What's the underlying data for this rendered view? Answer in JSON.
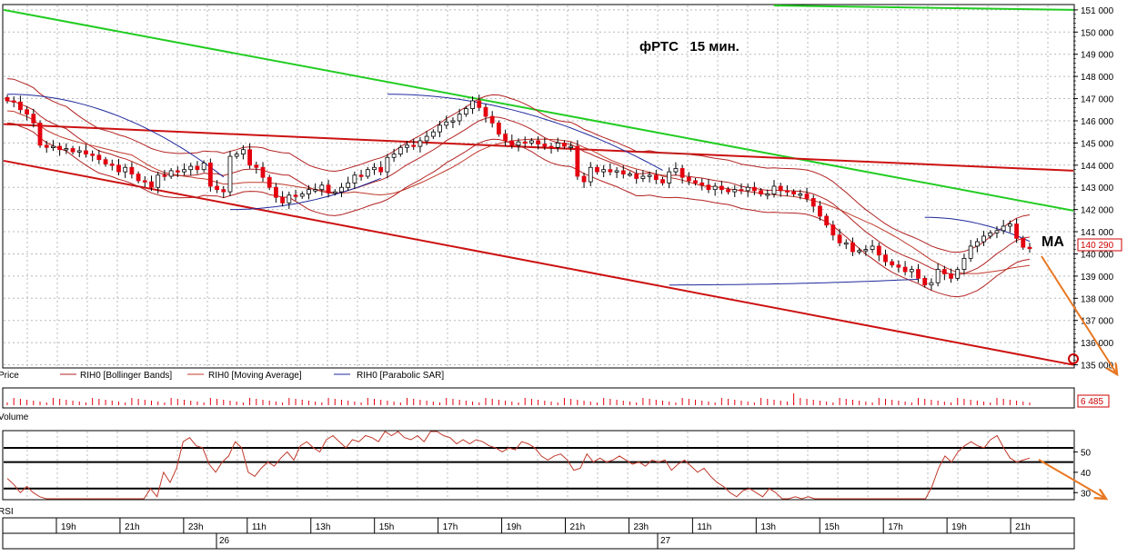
{
  "chart_title": "фРТС   15 мин.",
  "annotation_ma": "MA",
  "colors": {
    "up": "#ffffff",
    "down": "#e4000f",
    "bollinger": "#b22222",
    "ma": "#c0392b",
    "sar": "#1f2a9c",
    "trend_green": "#22cc22",
    "trend_red": "#cc1111",
    "arrow": "#e87722",
    "grid": "#b8b8b8"
  },
  "chart_data": [
    {
      "type": "candlestick",
      "title": "фРТС   15 мин.",
      "ylim": [
        134900,
        151200
      ],
      "y_ticks": [
        "151 000",
        "150 000",
        "149 000",
        "148 000",
        "147 000",
        "146 000",
        "145 000",
        "144 000",
        "143 000",
        "142 000",
        "141 000",
        "140 000",
        "139 000",
        "138 000",
        "137 000",
        "136 000",
        "135 000"
      ],
      "y_tick_values": [
        151000,
        150000,
        149000,
        148000,
        147000,
        146000,
        145000,
        144000,
        143000,
        142000,
        141000,
        140000,
        139000,
        138000,
        137000,
        136000,
        135000
      ],
      "last_price_label": "140 290",
      "last_price": 140290,
      "legend": [
        "Price",
        "RIH0 [Bollinger Bands]",
        "RIH0 [Moving Average]",
        "RIH0 [Parabolic SAR]"
      ],
      "grid": true,
      "close": [
        146900,
        146850,
        146500,
        146300,
        145900,
        144900,
        144800,
        144850,
        144700,
        144750,
        144600,
        144650,
        144500,
        144450,
        144250,
        144050,
        144000,
        143700,
        143900,
        143600,
        143300,
        143250,
        143000,
        143550,
        143500,
        143750,
        143700,
        143800,
        143950,
        143800,
        144100,
        143050,
        142900,
        142800,
        144400,
        144500,
        144700,
        144000,
        143900,
        143450,
        143000,
        142550,
        142300,
        142650,
        142600,
        142700,
        142900,
        142900,
        143100,
        142750,
        142800,
        143000,
        143200,
        143550,
        143500,
        143800,
        143900,
        143700,
        144350,
        144500,
        144800,
        144900,
        144850,
        145100,
        145300,
        145500,
        145800,
        145950,
        146000,
        146300,
        146550,
        146900,
        146600,
        146200,
        145900,
        145400,
        145100,
        144900,
        145050,
        145000,
        145100,
        144950,
        144850,
        144800,
        145000,
        144850,
        144850,
        143500,
        143250,
        143900,
        143700,
        143800,
        143700,
        143750,
        143600,
        143600,
        143400,
        143500,
        143550,
        143350,
        143200,
        143700,
        143850,
        143450,
        143300,
        143200,
        143100,
        142900,
        143050,
        142900,
        142800,
        142900,
        142850,
        143000,
        142850,
        142700,
        142700,
        143050,
        142850,
        142800,
        142700,
        142700,
        142500,
        142150,
        141700,
        141300,
        140850,
        140500,
        140500,
        140100,
        140150,
        140200,
        140350,
        139950,
        139650,
        139500,
        139400,
        139200,
        139300,
        138900,
        138600,
        138700,
        139300,
        139100,
        138900,
        139300,
        139800,
        140350,
        140550,
        140800,
        140950,
        141050,
        141250,
        141350,
        140700,
        140300,
        140290
      ],
      "sar_flip_indices": [
        34,
        58,
        101,
        140
      ],
      "bollinger_offset": 1000,
      "ma_offset": 450,
      "trend_lines": [
        {
          "name": "upper-resistance-green",
          "from": [
            0,
            151000
          ],
          "to": [
            1.0,
            141950
          ]
        },
        {
          "name": "top-green",
          "from": [
            0.72,
            151200
          ],
          "to": [
            1.0,
            151000
          ]
        },
        {
          "name": "middle-red",
          "from": [
            0,
            145850
          ],
          "to": [
            1.0,
            143750
          ]
        },
        {
          "name": "lower-channel-red",
          "from": [
            0,
            144200
          ],
          "to": [
            1.0,
            135000
          ]
        }
      ]
    },
    {
      "type": "bar",
      "title": "Volume",
      "last_value_label": "6 485",
      "last_value": 6485
    },
    {
      "type": "line",
      "title": "RSI",
      "y_ticks": [
        "50",
        "40",
        "30"
      ],
      "y_tick_values": [
        50,
        40,
        30
      ],
      "ylim": [
        27,
        60
      ],
      "levels": [
        52,
        45,
        32
      ],
      "values": [
        37,
        34,
        30,
        33,
        30,
        28,
        26,
        24,
        22,
        25,
        24,
        22,
        21,
        23,
        25,
        26,
        25,
        27,
        26,
        24,
        26,
        27,
        32,
        28,
        40,
        35,
        42,
        55,
        57,
        53,
        52,
        44,
        40,
        45,
        48,
        55,
        52,
        40,
        38,
        42,
        45,
        43,
        47,
        50,
        46,
        53,
        55,
        52,
        50,
        56,
        58,
        55,
        52,
        56,
        55,
        58,
        57,
        55,
        61,
        58,
        60,
        57,
        56,
        58,
        55,
        60,
        61,
        58,
        57,
        54,
        56,
        54,
        56,
        55,
        53,
        52,
        50,
        52,
        51,
        55,
        54,
        52,
        48,
        46,
        48,
        49,
        46,
        41,
        42,
        49,
        45,
        47,
        45,
        46,
        48,
        46,
        44,
        45,
        43,
        46,
        45,
        46,
        41,
        44,
        46,
        43,
        40,
        42,
        38,
        35,
        33,
        30,
        28,
        31,
        32,
        30,
        28,
        32,
        30,
        27,
        26,
        28,
        25,
        28,
        26,
        24,
        25,
        22,
        26,
        24,
        22,
        23,
        25,
        20,
        21,
        24,
        23,
        21,
        22,
        25,
        23,
        27,
        33,
        42,
        48,
        45,
        50,
        53,
        55,
        53,
        52,
        56,
        58,
        52,
        47,
        45,
        46,
        47
      ],
      "end_value": 46
    }
  ],
  "x_axis": {
    "hour_ticks": [
      "19h",
      "21h",
      "23h",
      "11h",
      "13h",
      "15h",
      "17h",
      "19h",
      "21h",
      "23h",
      "11h",
      "13h",
      "15h",
      "17h",
      "19h",
      "21h"
    ],
    "day_ticks": [
      "26",
      "27"
    ]
  }
}
